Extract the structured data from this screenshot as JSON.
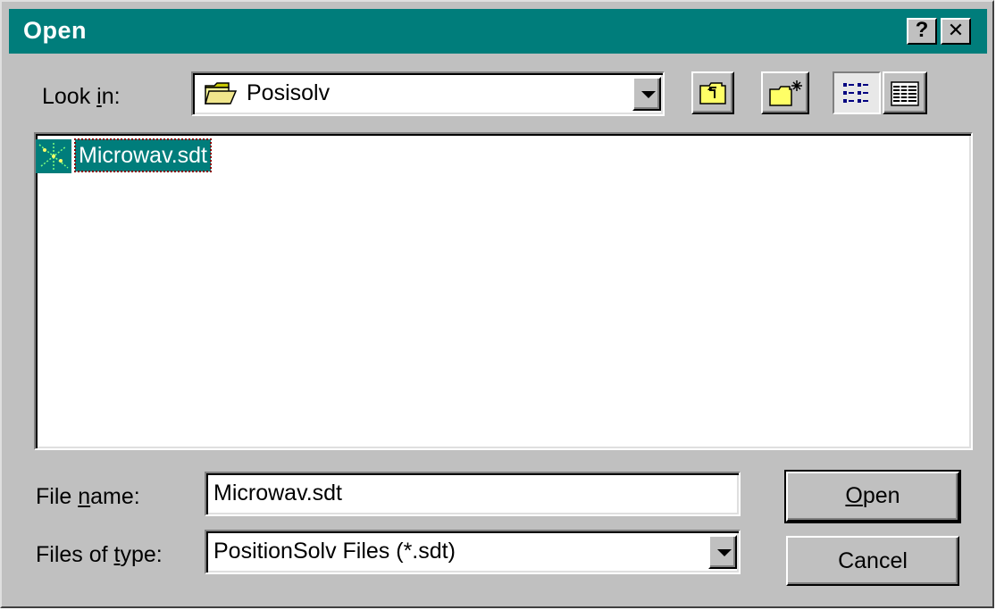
{
  "titlebar": {
    "title": "Open",
    "help_label": "?",
    "close_label": "✕"
  },
  "look_in": {
    "label_pre": "Look ",
    "label_accel": "i",
    "label_post": "n:",
    "value": "Posisolv",
    "icon": "folder-icon"
  },
  "toolbar": {
    "up_one_level_icon": "up-folder-icon",
    "new_folder_icon": "new-folder-icon",
    "list_view_icon": "list-view-icon",
    "details_view_icon": "details-view-icon"
  },
  "files": [
    {
      "name": "Microwav.sdt",
      "icon": "sdt-file-icon",
      "selected": true
    }
  ],
  "file_name": {
    "label_pre": "File ",
    "label_accel": "n",
    "label_post": "ame:",
    "value": "Microwav.sdt"
  },
  "file_type": {
    "label_pre": "Files of ",
    "label_accel": "t",
    "label_post": "ype:",
    "value": "PositionSolv Files (*.sdt)"
  },
  "buttons": {
    "open_accel": "O",
    "open_rest": "pen",
    "cancel": "Cancel"
  },
  "colors": {
    "titlebar": "#007d7b",
    "face": "#c0c0c0",
    "selection": "#007d7b"
  }
}
